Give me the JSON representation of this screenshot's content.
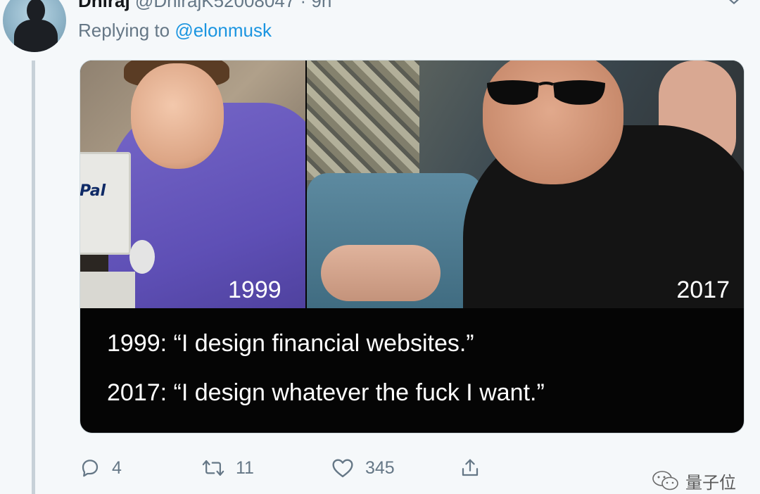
{
  "tweet": {
    "display_name": "Dhiraj",
    "handle": "@DhirajK52008047",
    "separator": "·",
    "time": "9h",
    "replying_prefix": "Replying to",
    "replying_to": "@elonmusk"
  },
  "media": {
    "left_year": "1999",
    "right_year": "2017",
    "monitor_text": "Pal",
    "caption_1": "1999: “I design financial websites.”",
    "caption_2": "2017: “I design whatever the fuck I want.”"
  },
  "actions": {
    "reply_count": "4",
    "retweet_count": "11",
    "like_count": "345"
  },
  "icons": {
    "reply": "reply-icon",
    "retweet": "retweet-icon",
    "like": "heart-icon",
    "share": "share-icon",
    "menu": "chevron-down-icon",
    "watermark": "wechat-icon"
  },
  "watermark": {
    "text": "量子位"
  },
  "colors": {
    "link": "#1b95e0",
    "muted": "#657786",
    "background": "#f5f8fa"
  }
}
